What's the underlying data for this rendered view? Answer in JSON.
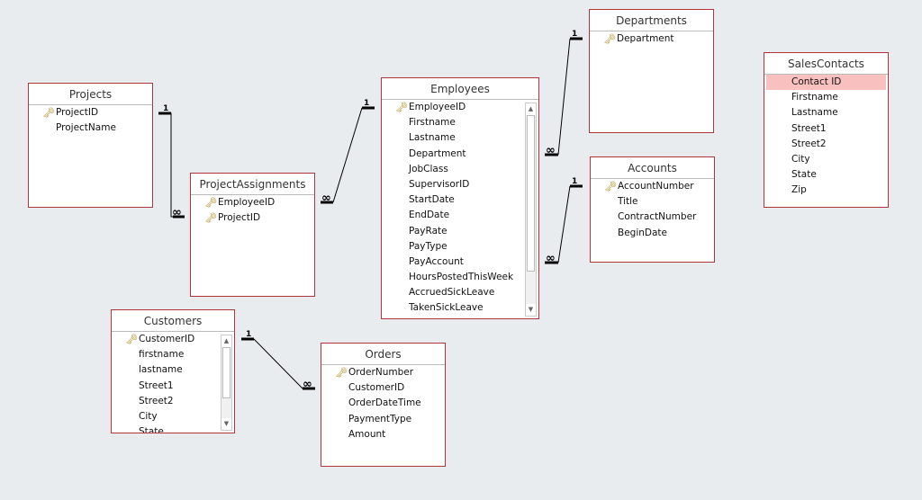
{
  "tables": {
    "projects": {
      "title": "Projects",
      "fields": [
        "ProjectID",
        "ProjectName"
      ]
    },
    "project_assignments": {
      "title": "ProjectAssignments",
      "fields": [
        "EmployeeID",
        "ProjectID"
      ]
    },
    "employees": {
      "title": "Employees",
      "fields": [
        "EmployeeID",
        "Firstname",
        "Lastname",
        "Department",
        "JobClass",
        "SupervisorID",
        "StartDate",
        "EndDate",
        "PayRate",
        "PayType",
        "PayAccount",
        "HoursPostedThisWeek",
        "AccruedSickLeave",
        "TakenSickLeave"
      ]
    },
    "departments": {
      "title": "Departments",
      "fields": [
        "Department"
      ]
    },
    "accounts": {
      "title": "Accounts",
      "fields": [
        "AccountNumber",
        "Title",
        "ContractNumber",
        "BeginDate"
      ]
    },
    "sales_contacts": {
      "title": "SalesContacts",
      "fields": [
        "Contact ID",
        "Firstname",
        "Lastname",
        "Street1",
        "Street2",
        "City",
        "State",
        "Zip"
      ]
    },
    "customers": {
      "title": "Customers",
      "fields": [
        "CustomerID",
        "firstname",
        "lastname",
        "Street1",
        "Street2",
        "City",
        "State"
      ]
    },
    "orders": {
      "title": "Orders",
      "fields": [
        "OrderNumber",
        "CustomerID",
        "OrderDateTime",
        "PaymentType",
        "Amount"
      ]
    }
  },
  "relationship_labels": {
    "one": "1",
    "many": "∞"
  },
  "colors": {
    "border": "#b2343a",
    "selected": "#f9c0c0",
    "background": "#e9ecef"
  }
}
